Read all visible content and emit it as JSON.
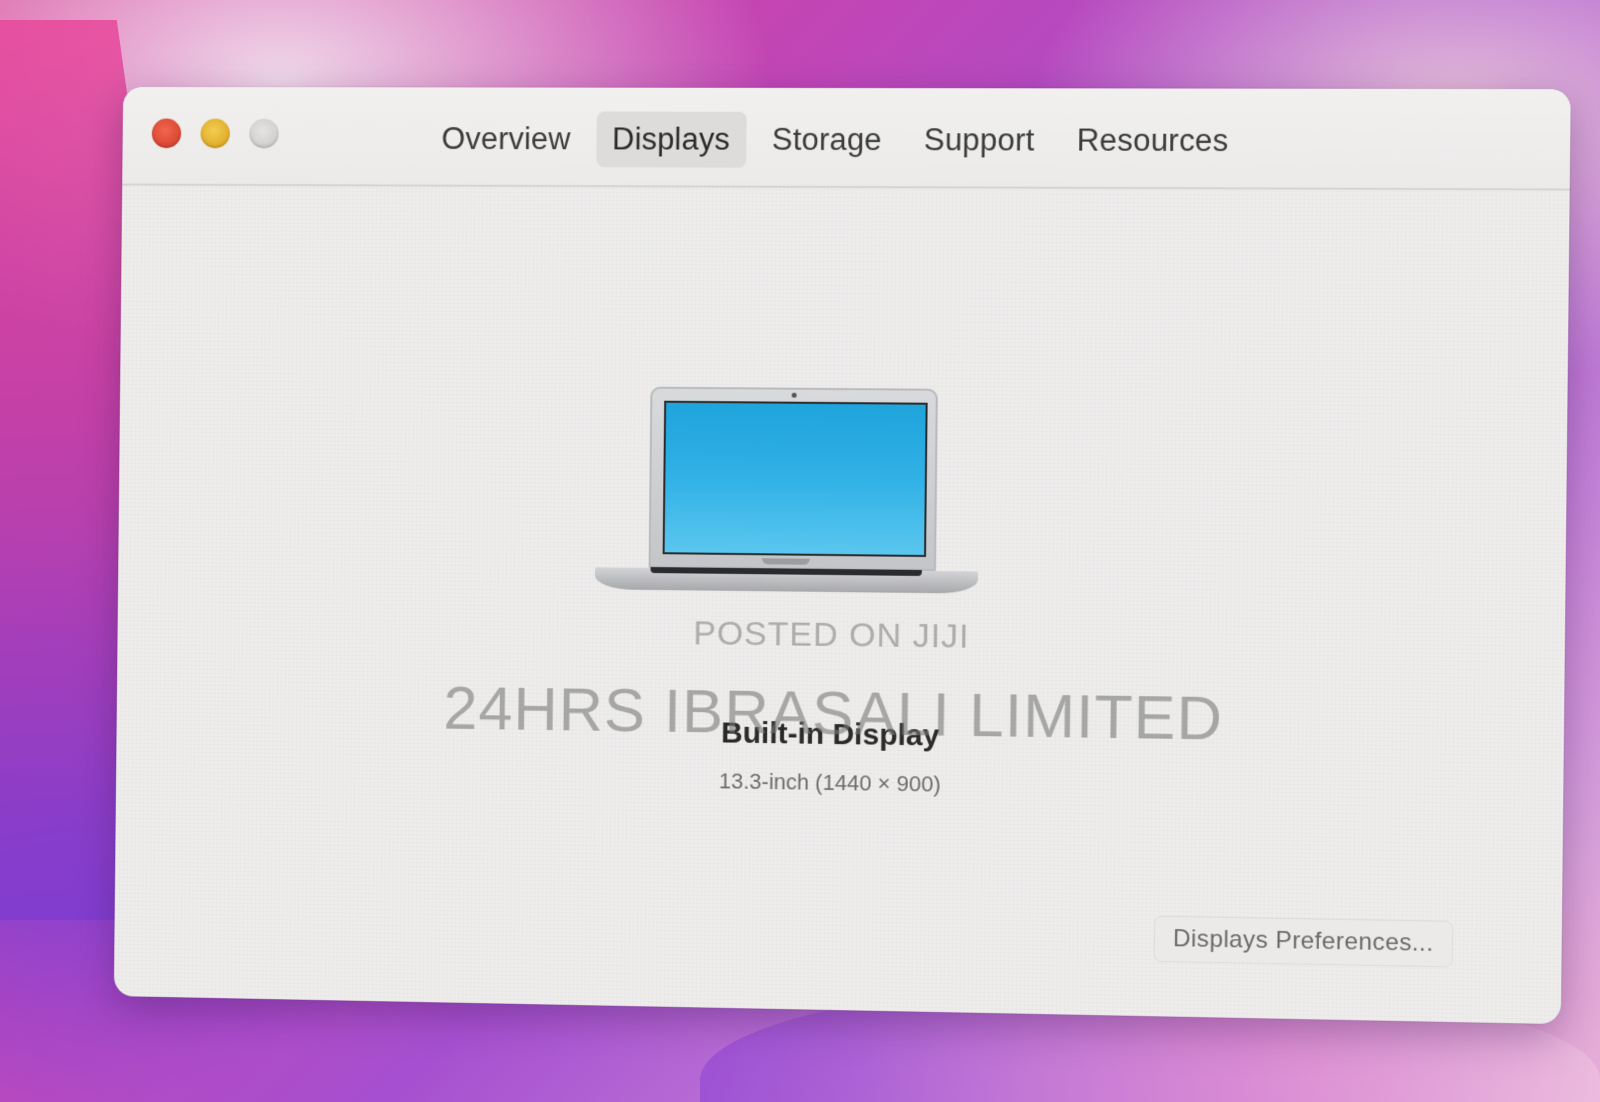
{
  "window": {
    "tabs": [
      {
        "label": "Overview",
        "active": false
      },
      {
        "label": "Displays",
        "active": true
      },
      {
        "label": "Storage",
        "active": false
      },
      {
        "label": "Support",
        "active": false
      },
      {
        "label": "Resources",
        "active": false
      }
    ]
  },
  "display": {
    "icon": "laptop-icon",
    "name": "Built-in Display",
    "spec": "13.3-inch (1440 × 900)"
  },
  "buttons": {
    "preferences_label": "Displays Preferences..."
  },
  "watermark": {
    "line1": "POSTED ON JIJI",
    "line2": "24HRS IBRASALI LIMITED"
  },
  "colors": {
    "close_light": "#e2533d",
    "minimize_light": "#e8bb37",
    "zoom_light": "#d9d8d7",
    "screen_blue": "#2aaae2"
  }
}
